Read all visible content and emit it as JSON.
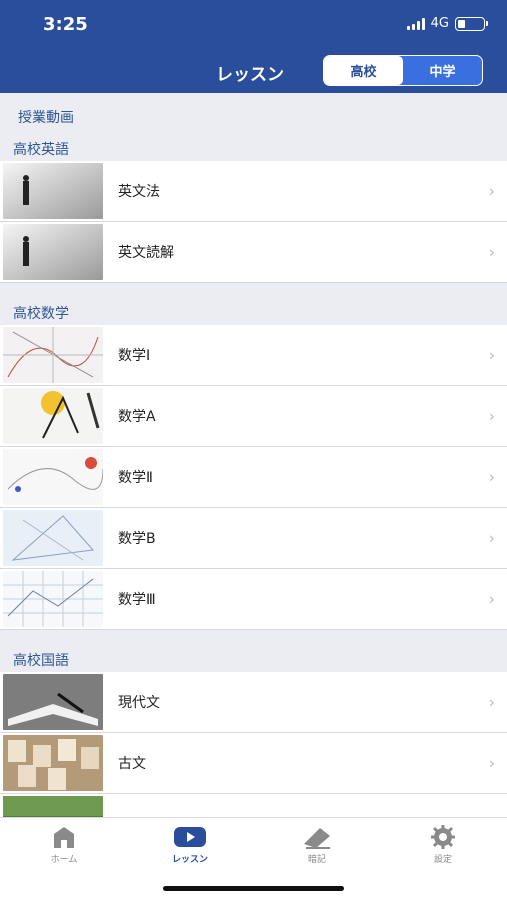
{
  "status_bar": {
    "time": "3:25",
    "network": "4G"
  },
  "nav": {
    "title": "レッスン",
    "segments": [
      "高校",
      "中学"
    ],
    "selected_segment": "高校"
  },
  "top_label": "授業動画",
  "sections": [
    {
      "title": "高校英語",
      "items": [
        {
          "label": "英文法",
          "thumb": "person-icon"
        },
        {
          "label": "英文読解",
          "thumb": "person-icon"
        }
      ]
    },
    {
      "title": "高校数学",
      "items": [
        {
          "label": "数学Ⅰ",
          "thumb": "graph-icon"
        },
        {
          "label": "数学A",
          "thumb": "compass-icon"
        },
        {
          "label": "数学Ⅱ",
          "thumb": "chart-icon"
        },
        {
          "label": "数学B",
          "thumb": "geometry-icon"
        },
        {
          "label": "数学Ⅲ",
          "thumb": "grid-icon"
        }
      ]
    },
    {
      "title": "高校国語",
      "items": [
        {
          "label": "現代文",
          "thumb": "book-icon"
        },
        {
          "label": "古文",
          "thumb": "cards-icon"
        },
        {
          "label": "",
          "thumb": "grass-icon"
        }
      ]
    }
  ],
  "tabbar": {
    "items": [
      {
        "label": "ホーム",
        "icon": "home-icon"
      },
      {
        "label": "レッスン",
        "icon": "play-icon",
        "active": true
      },
      {
        "label": "暗記",
        "icon": "eraser-icon"
      },
      {
        "label": "設定",
        "icon": "gear-icon"
      }
    ]
  },
  "colors": {
    "header": "#2a4e9b",
    "accent": "#2a4e9b",
    "section_text": "#2f5596",
    "background": "#ebedf2"
  }
}
